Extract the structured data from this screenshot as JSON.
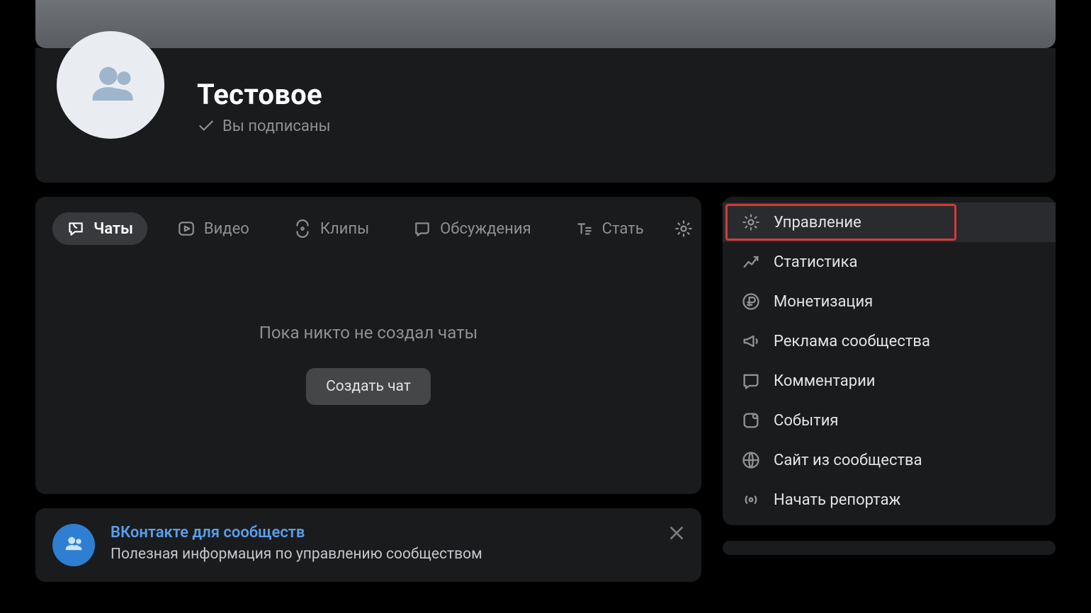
{
  "header": {
    "title": "Тестовое",
    "subscribed_label": "Вы подписаны"
  },
  "tabs": [
    {
      "key": "chats",
      "label": "Чаты",
      "icon": "chat-icon",
      "active": true
    },
    {
      "key": "video",
      "label": "Видео",
      "icon": "play-icon",
      "active": false
    },
    {
      "key": "clips",
      "label": "Клипы",
      "icon": "clips-icon",
      "active": false
    },
    {
      "key": "discussions",
      "label": "Обсуждения",
      "icon": "speech-icon",
      "active": false
    },
    {
      "key": "articles",
      "label": "Стать",
      "icon": "text-icon",
      "active": false
    }
  ],
  "empty_state": {
    "text": "Пока никто не создал чаты",
    "button": "Создать чат"
  },
  "promo": {
    "title": "ВКонтакте для сообществ",
    "subtitle": "Полезная информация по управлению сообществом"
  },
  "side_menu": [
    {
      "key": "manage",
      "label": "Управление",
      "icon": "gear-icon",
      "highlight": true
    },
    {
      "key": "stats",
      "label": "Статистика",
      "icon": "chart-icon",
      "highlight": false
    },
    {
      "key": "monetization",
      "label": "Монетизация",
      "icon": "ruble-icon",
      "highlight": false
    },
    {
      "key": "ads",
      "label": "Реклама сообщества",
      "icon": "megaphone-icon",
      "highlight": false
    },
    {
      "key": "comments",
      "label": "Комментарии",
      "icon": "speech-icon",
      "highlight": false
    },
    {
      "key": "events",
      "label": "События",
      "icon": "square-plus-icon",
      "highlight": false
    },
    {
      "key": "site",
      "label": "Сайт из сообщества",
      "icon": "globe-icon",
      "highlight": false
    },
    {
      "key": "report",
      "label": "Начать репортаж",
      "icon": "broadcast-icon",
      "highlight": false
    }
  ]
}
